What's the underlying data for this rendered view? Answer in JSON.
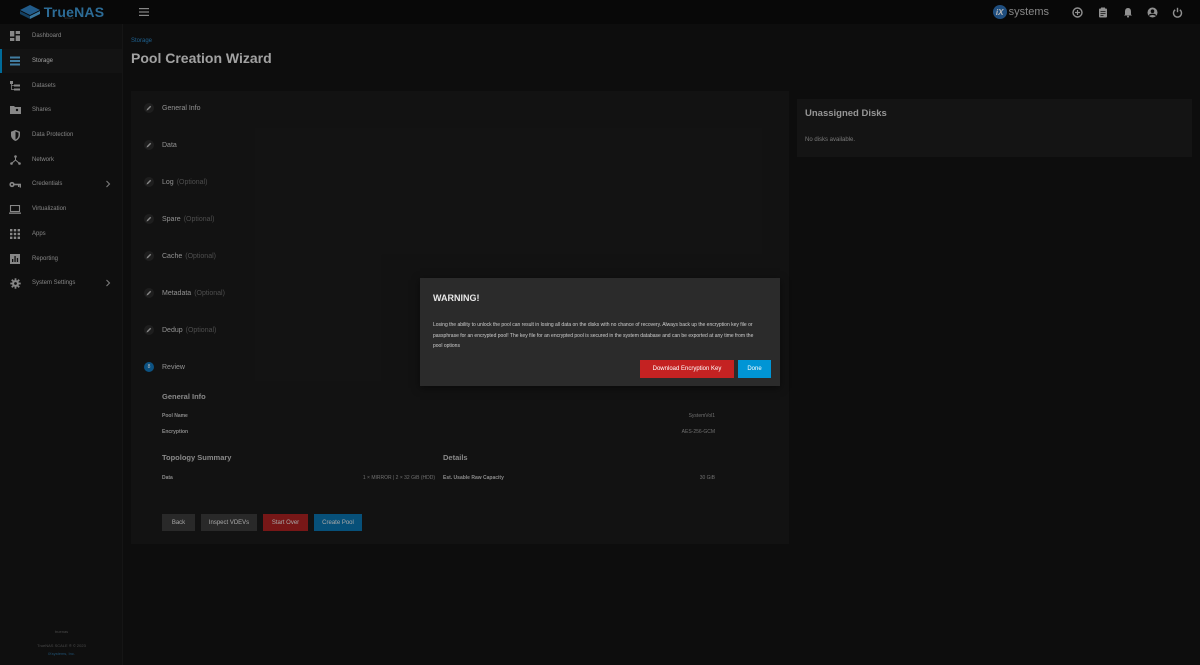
{
  "header": {
    "logo_text": "TrueNAS",
    "logo_subtext": "SCALE",
    "vendor_letter": "iX",
    "vendor_text": "systems"
  },
  "sidebar": {
    "items": [
      {
        "label": "Dashboard",
        "icon": "dashboard-icon"
      },
      {
        "label": "Storage",
        "icon": "storage-icon",
        "active": true
      },
      {
        "label": "Datasets",
        "icon": "datasets-icon"
      },
      {
        "label": "Shares",
        "icon": "shares-icon"
      },
      {
        "label": "Data Protection",
        "icon": "shield-icon"
      },
      {
        "label": "Network",
        "icon": "network-icon"
      },
      {
        "label": "Credentials",
        "icon": "key-icon",
        "has_children": true
      },
      {
        "label": "Virtualization",
        "icon": "laptop-icon"
      },
      {
        "label": "Apps",
        "icon": "apps-grid-icon"
      },
      {
        "label": "Reporting",
        "icon": "reporting-icon"
      },
      {
        "label": "System Settings",
        "icon": "gear-icon",
        "has_children": true
      }
    ],
    "footer_hostname": "truenas",
    "footer_copyright": "TrueNAS SCALE ® © 2023",
    "footer_company": "iXsystems, Inc."
  },
  "page": {
    "breadcrumb": "Storage",
    "title": "Pool Creation Wizard"
  },
  "wizard": {
    "steps": [
      {
        "label": "General Info",
        "optional": ""
      },
      {
        "label": "Data",
        "optional": ""
      },
      {
        "label": "Log",
        "optional": "(Optional)"
      },
      {
        "label": "Spare",
        "optional": "(Optional)"
      },
      {
        "label": "Cache",
        "optional": "(Optional)"
      },
      {
        "label": "Metadata",
        "optional": "(Optional)"
      },
      {
        "label": "Dedup",
        "optional": "(Optional)"
      },
      {
        "label": "Review",
        "optional": "",
        "number": "8"
      }
    ],
    "review": {
      "general_info_heading": "General Info",
      "pool_name_label": "Pool Name",
      "pool_name_value": "SystemVol1",
      "encryption_label": "Encryption",
      "encryption_value": "AES-256-GCM",
      "topology_heading": "Topology Summary",
      "details_heading": "Details",
      "data_label": "Data",
      "data_value": "1 × MIRROR | 2 × 32 GiB (HDD)",
      "capacity_label": "Est. Usable Raw Capacity",
      "capacity_value": "30 GiB"
    },
    "buttons": {
      "back": "Back",
      "inspect": "Inspect VDEVs",
      "start_over": "Start Over",
      "create": "Create Pool"
    }
  },
  "unassigned": {
    "title": "Unassigned Disks",
    "empty_text": "No disks available."
  },
  "dialog": {
    "title": "WARNING!",
    "message": "Losing the ability to unlock the pool can result in losing all data on the disks with no chance of recovery. Always back up the encryption key file or passphrase for an encrypted pool! The key file for an encrypted pool is secured in the system database and can be exported at any time from the pool options",
    "download_label": "Download Encryption Key",
    "done_label": "Done"
  },
  "colors": {
    "accent": "#0095d5",
    "danger": "#c42222",
    "primary_button": "#0a6fa8"
  }
}
